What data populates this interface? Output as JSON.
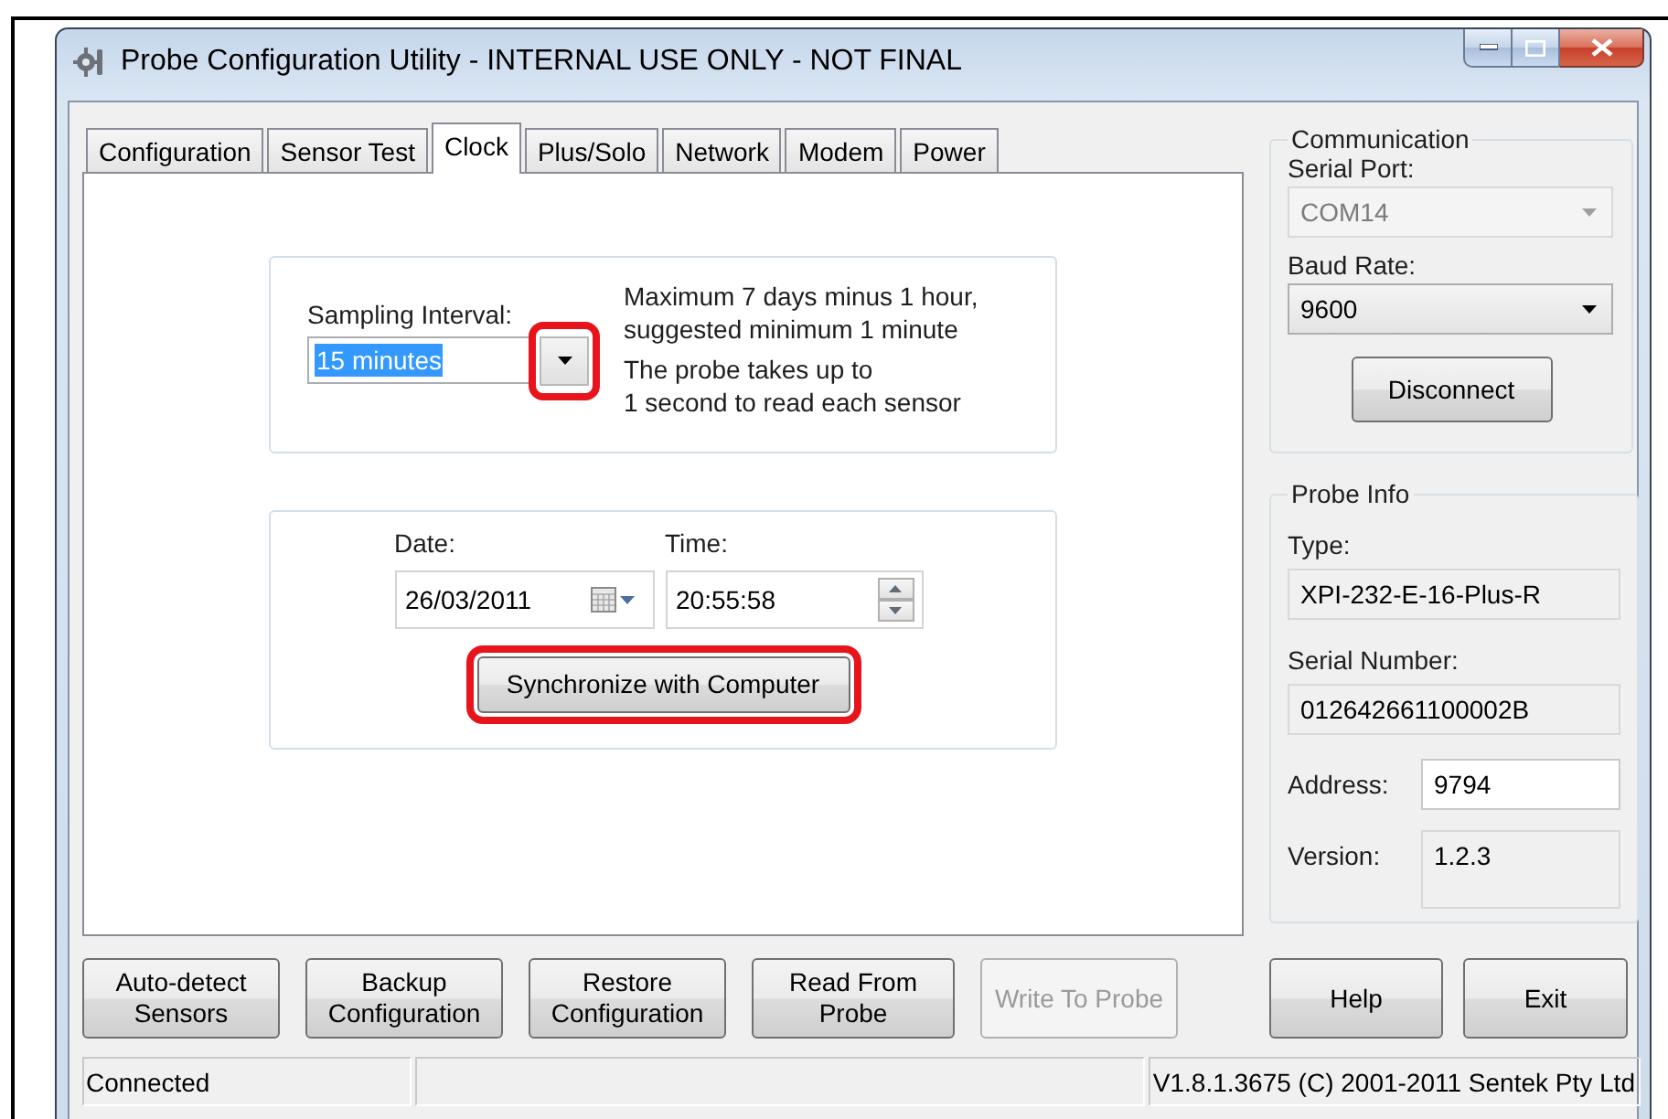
{
  "window": {
    "title": "Probe Configuration Utility - INTERNAL USE ONLY - NOT FINAL"
  },
  "tabs": [
    {
      "label": "Configuration",
      "selected": false
    },
    {
      "label": "Sensor Test",
      "selected": false
    },
    {
      "label": "Clock",
      "selected": true
    },
    {
      "label": "Plus/Solo",
      "selected": false
    },
    {
      "label": "Network",
      "selected": false
    },
    {
      "label": "Modem",
      "selected": false
    },
    {
      "label": "Power",
      "selected": false
    }
  ],
  "sampling": {
    "label": "Sampling Interval:",
    "value": "15 minutes",
    "value_selected": true,
    "dropdown_highlighted": true,
    "notes": [
      "Maximum 7 days minus 1 hour,\nsuggested minimum 1 minute",
      "The probe takes up to\n1 second to read each sensor"
    ]
  },
  "clock": {
    "date_label": "Date:",
    "date": "26/03/2011",
    "time_label": "Time:",
    "time": "20:55:58",
    "sync_button": {
      "label": "Synchronize with Computer",
      "highlighted": true
    }
  },
  "communication": {
    "title": "Communication",
    "serial_port": {
      "label": "Serial Port:",
      "value": "COM14",
      "disabled": true
    },
    "baud_rate": {
      "label": "Baud Rate:",
      "value": "9600",
      "disabled": false
    },
    "disconnect_button": "Disconnect"
  },
  "probe_info": {
    "title": "Probe Info",
    "fields": [
      {
        "kind": "stacked",
        "label": "Type:",
        "value": "XPI-232-E-16-Plus-R"
      },
      {
        "kind": "stacked",
        "label": "Serial Number:",
        "value": "012642661100002B"
      },
      {
        "kind": "editable",
        "label": "Address:",
        "value": "9794"
      },
      {
        "kind": "inline",
        "label": "Version:",
        "value": "1.2.3"
      }
    ]
  },
  "actions": [
    {
      "label": "Auto-detect\nSensors",
      "disabled": false
    },
    {
      "label": "Backup\nConfiguration",
      "disabled": false
    },
    {
      "label": "Restore\nConfiguration",
      "disabled": false
    },
    {
      "label": "Read From\nProbe",
      "disabled": false
    },
    {
      "label": "Write To Probe",
      "disabled": true
    }
  ],
  "dialog_buttons": [
    "Help",
    "Exit"
  ],
  "status_bar": {
    "status": "Connected",
    "version": "V1.8.1.3675 (C) 2001-2011 Sentek Pty Ltd"
  }
}
